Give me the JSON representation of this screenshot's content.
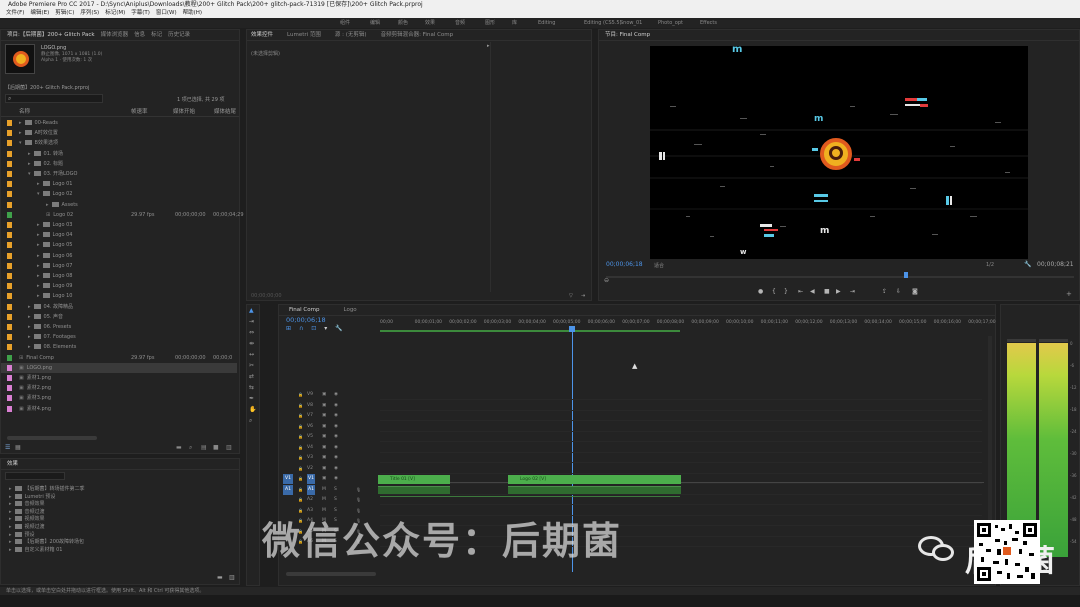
{
  "titlebar": {
    "text": "Adobe Premiere Pro CC 2017 - D:\\Sync\\Aniplus\\Downloads\\教程\\200+ Glitch Pack\\200+ glitch-pack-71319 [已保存]\\200+ Glitch Pack.prproj"
  },
  "menu": [
    "文件(F)",
    "编辑(E)",
    "剪辑(C)",
    "序列(S)",
    "标记(M)",
    "字幕(T)",
    "窗口(W)",
    "帮助(H)"
  ],
  "workspaces": [
    "组件",
    "编辑",
    "颜色",
    "效果",
    "音频",
    "图形",
    "库",
    "Editing",
    "Editing (CS5.5)",
    "Snow_01",
    "Photo_opt",
    "Effects"
  ],
  "project": {
    "tabs": [
      "项目:【后期菌】200+ Glitch Pack",
      "媒体浏览器",
      "信息",
      "标记",
      "历史记录"
    ],
    "clip_name": "LOGO.png",
    "clip_info": "静止图像, 1071 x 1081 (1.0)\nAlpha 1 · 使用次数: 1 次",
    "project_file": "【后期菌】200+ Glitch Pack.prproj",
    "selection": "1 项已选择, 共 29 项",
    "col_name": "名称",
    "col_fps": "帧速率",
    "col_start": "媒体开始",
    "col_end": "媒体结尾",
    "items": [
      {
        "label": "00-Reads",
        "indent": 0,
        "kind": "folder",
        "color": "#e8a12a"
      },
      {
        "label": "A时效位置",
        "indent": 0,
        "kind": "folder",
        "color": "#e8a12a"
      },
      {
        "label": "B效果选项",
        "indent": 0,
        "kind": "folder",
        "color": "#e8a12a",
        "open": true
      },
      {
        "label": "01. 转场",
        "indent": 1,
        "kind": "folder",
        "color": "#e8a12a"
      },
      {
        "label": "02. 标题",
        "indent": 1,
        "kind": "folder",
        "color": "#e8a12a"
      },
      {
        "label": "03. 开场LOGO",
        "indent": 1,
        "kind": "folder",
        "color": "#e8a12a",
        "open": true
      },
      {
        "label": "Logo 01",
        "indent": 2,
        "kind": "folder",
        "color": "#e8a12a"
      },
      {
        "label": "Logo 02",
        "indent": 2,
        "kind": "folder",
        "color": "#e8a12a",
        "open": true
      },
      {
        "label": "Assets",
        "indent": 3,
        "kind": "folder",
        "color": "#e8a12a"
      },
      {
        "label": "Logo 02",
        "indent": 3,
        "kind": "seq",
        "color": "#3fa14a",
        "fps": "29.97 fps",
        "start": "00;00;00;00",
        "end": "00;00;04;29"
      },
      {
        "label": "Logo 03",
        "indent": 2,
        "kind": "folder",
        "color": "#e8a12a"
      },
      {
        "label": "Logo 04",
        "indent": 2,
        "kind": "folder",
        "color": "#e8a12a"
      },
      {
        "label": "Logo 05",
        "indent": 2,
        "kind": "folder",
        "color": "#e8a12a"
      },
      {
        "label": "Logo 06",
        "indent": 2,
        "kind": "folder",
        "color": "#e8a12a"
      },
      {
        "label": "Logo 07",
        "indent": 2,
        "kind": "folder",
        "color": "#e8a12a"
      },
      {
        "label": "Logo 08",
        "indent": 2,
        "kind": "folder",
        "color": "#e8a12a"
      },
      {
        "label": "Logo 09",
        "indent": 2,
        "kind": "folder",
        "color": "#e8a12a"
      },
      {
        "label": "Logo 10",
        "indent": 2,
        "kind": "folder",
        "color": "#e8a12a"
      },
      {
        "label": "04. 故障精品",
        "indent": 1,
        "kind": "folder",
        "color": "#e8a12a"
      },
      {
        "label": "05. 声音",
        "indent": 1,
        "kind": "folder",
        "color": "#e8a12a"
      },
      {
        "label": "06. Presets",
        "indent": 1,
        "kind": "folder",
        "color": "#e8a12a"
      },
      {
        "label": "07. Footages",
        "indent": 1,
        "kind": "folder",
        "color": "#e8a12a"
      },
      {
        "label": "08. Elements",
        "indent": 1,
        "kind": "folder",
        "color": "#e8a12a"
      },
      {
        "label": "Final Comp",
        "indent": 0,
        "kind": "seq",
        "color": "#3fa14a",
        "fps": "29.97 fps",
        "start": "00;00;00;00",
        "end": "00;00;0"
      },
      {
        "label": "LOGO.png",
        "indent": 0,
        "kind": "img",
        "color": "#d97fd2",
        "selected": true
      },
      {
        "label": "素材1.png",
        "indent": 0,
        "kind": "img",
        "color": "#d97fd2"
      },
      {
        "label": "素材2.png",
        "indent": 0,
        "kind": "img",
        "color": "#d97fd2"
      },
      {
        "label": "素材3.png",
        "indent": 0,
        "kind": "img",
        "color": "#d97fd2"
      },
      {
        "label": "素材4.png",
        "indent": 0,
        "kind": "img",
        "color": "#d97fd2"
      }
    ]
  },
  "effects": {
    "tab": "效果",
    "items": [
      "【后期菌】转场插件第二季",
      "Lumetri 预设",
      "音频效果",
      "音频过渡",
      "视频效果",
      "视频过渡",
      "预设",
      "【后期菌】200故障转场包",
      "自定义素材箱 01"
    ]
  },
  "source": {
    "tabs": [
      "效果控件",
      "Lumetri 范围",
      "源 : (无剪辑)",
      "音频剪辑混合器: Final Comp"
    ],
    "no_clip": "(未选择剪辑)",
    "timecode": "00;00;00;00"
  },
  "program": {
    "tab": "节目: Final Comp",
    "timecode_left": "00;00;06;18",
    "fit": "适合",
    "quality": "1/2",
    "timecode_right": "00;00;08;21"
  },
  "timeline": {
    "tabs": [
      "Final Comp",
      "Logo"
    ],
    "timecode": "00;00;06;18",
    "ruler": [
      "00;00",
      "00;00;01;00",
      "00;00;02;00",
      "00;00;03;00",
      "00;00;04;00",
      "00;00;05;00",
      "00;00;06;00",
      "00;00;07;00",
      "00;00;08;00",
      "00;00;09;00",
      "00;00;10;00",
      "00;00;11;00",
      "00;00;12;00",
      "00;00;13;00",
      "00;00;14;00",
      "00;00;15;00",
      "00;00;16;00",
      "00;00;17;00"
    ],
    "video_tracks": [
      "V9",
      "V8",
      "V7",
      "V6",
      "V5",
      "V4",
      "V3",
      "V2",
      "V1"
    ],
    "audio_tracks": [
      "A1",
      "A2",
      "A3",
      "A4",
      "A5",
      "A6"
    ],
    "clips": [
      {
        "label": "Title 01 [V]"
      },
      {
        "label": "Logo 02 [V]"
      }
    ]
  },
  "meters": {
    "labels": [
      "0",
      "-6",
      "-12",
      "-18",
      "-24",
      "-30",
      "-36",
      "-42",
      "-48",
      "-54"
    ],
    "solo": "S",
    "solo2": "S"
  },
  "status": {
    "text": "单击以选择，或单击空白处并拖动以进行框选。使用 Shift、Alt 和 Ctrl 可获得其他选项。"
  },
  "watermark": {
    "text": "微信公众号：后期菌",
    "brand": "后期菌"
  },
  "colors": {
    "accent": "#2e8ae6",
    "clip_green": "#4cae4c",
    "folder": "#e8a12a",
    "sequence": "#3fa14a",
    "image": "#d97fd2"
  }
}
